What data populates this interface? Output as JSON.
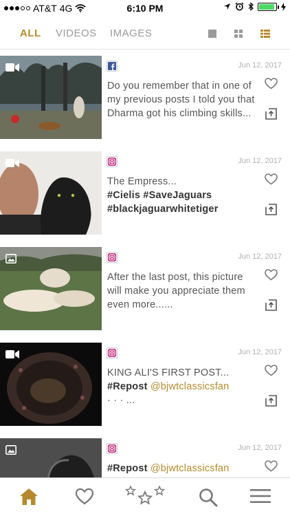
{
  "status_bar": {
    "carrier": "AT&T",
    "network": "4G",
    "time": "6:10 PM",
    "battery_level": 0.9,
    "icons": [
      "signal-dots-icon",
      "wifi-icon",
      "location-icon",
      "alarm-icon",
      "bluetooth-icon",
      "battery-icon",
      "charging-icon"
    ]
  },
  "tabs": [
    {
      "label": "ALL",
      "active": true
    },
    {
      "label": "VIDEOS",
      "active": false
    },
    {
      "label": "IMAGES",
      "active": false
    }
  ],
  "view_toggles": [
    "single-view-icon",
    "grid-view-icon",
    "list-view-icon"
  ],
  "accent_color": "#b58a2e",
  "posts": [
    {
      "network": "facebook",
      "media": "video",
      "date": "Jun 12, 2017",
      "lines": [
        {
          "parts": [
            {
              "t": "Do you remember that in one of",
              "s": "plain"
            }
          ]
        },
        {
          "parts": [
            {
              "t": "my previous posts I told you that",
              "s": "plain"
            }
          ]
        },
        {
          "parts": [
            {
              "t": "Dharma got his climbing skills...",
              "s": "plain"
            }
          ]
        }
      ]
    },
    {
      "network": "instagram",
      "media": "video",
      "date": "Jun 12, 2017",
      "lines": [
        {
          "parts": [
            {
              "t": "The Empress...",
              "s": "plain"
            }
          ]
        },
        {
          "parts": [
            {
              "t": "#Cielis #SaveJaguars",
              "s": "tag"
            }
          ]
        },
        {
          "parts": [
            {
              "t": "#blackjaguarwhitetiger",
              "s": "tag"
            }
          ]
        }
      ]
    },
    {
      "network": "instagram",
      "media": "image",
      "date": "Jun 12, 2017",
      "lines": [
        {
          "parts": [
            {
              "t": "After the last post, this picture",
              "s": "plain"
            }
          ]
        },
        {
          "parts": [
            {
              "t": "will make you appreciate them",
              "s": "plain"
            }
          ]
        },
        {
          "parts": [
            {
              "t": "even more......",
              "s": "plain"
            }
          ]
        }
      ]
    },
    {
      "network": "instagram",
      "media": "video",
      "date": "Jun 12, 2017",
      "lines": [
        {
          "parts": [
            {
              "t": "KING ALI'S FIRST POST...",
              "s": "plain"
            }
          ]
        },
        {
          "parts": [
            {
              "t": "#Repost",
              "s": "tag"
            },
            {
              "t": " @bjwtclassicsfan",
              "s": "mention"
            }
          ]
        },
        {
          "parts": [
            {
              "t": "· · · ...",
              "s": "plain"
            }
          ]
        }
      ]
    },
    {
      "network": "instagram",
      "media": "image",
      "date": "Jun 12, 2017",
      "lines": [
        {
          "parts": [
            {
              "t": "#Repost",
              "s": "tag"
            },
            {
              "t": " @bjwtclassicsfan",
              "s": "mention"
            }
          ]
        }
      ]
    }
  ],
  "bottom_nav": [
    "home-icon",
    "favorites-icon",
    "stars-icon",
    "search-icon",
    "menu-icon"
  ]
}
